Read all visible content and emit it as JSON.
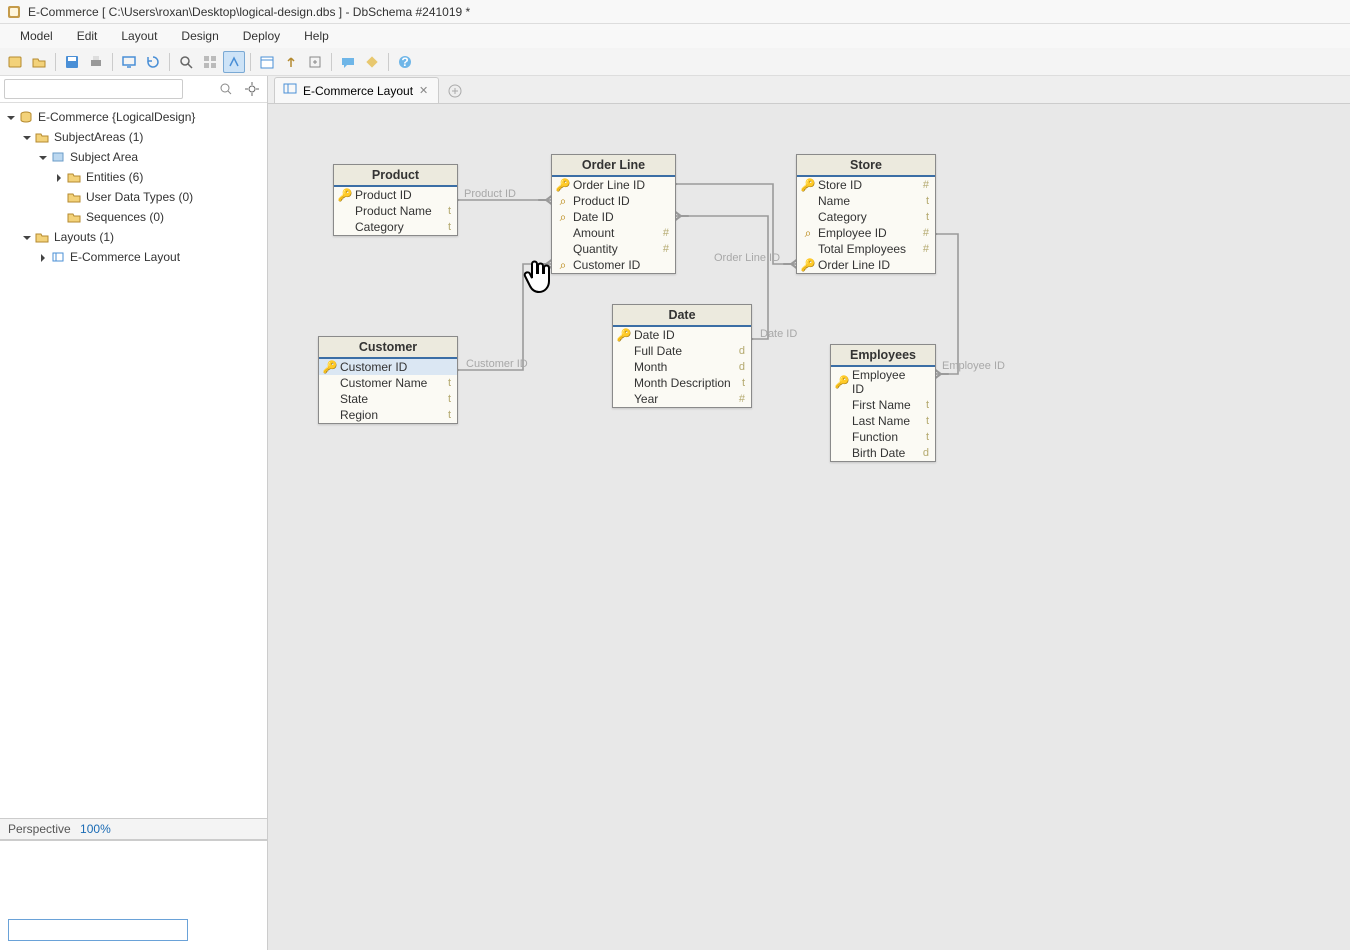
{
  "title": "E-Commerce [ C:\\Users\\roxan\\Desktop\\logical-design.dbs ] - DbSchema #241019 *",
  "menu": {
    "model": "Model",
    "edit": "Edit",
    "layout": "Layout",
    "design": "Design",
    "deploy": "Deploy",
    "help": "Help"
  },
  "tree": {
    "root": "E-Commerce {LogicalDesign}",
    "subjectAreas": "SubjectAreas (1)",
    "subjectArea": "Subject Area",
    "entities": "Entities (6)",
    "userDataTypes": "User Data Types (0)",
    "sequences": "Sequences (0)",
    "layouts": "Layouts (1)",
    "layoutItem": "E-Commerce Layout"
  },
  "perspective": {
    "label": "Perspective",
    "zoom": "100%"
  },
  "tab": {
    "label": "E-Commerce Layout",
    "close": "✕"
  },
  "labels": {
    "productId": "Product ID",
    "customerId": "Customer ID",
    "dateId": "Date ID",
    "orderLineId": "Order Line ID",
    "employeeId": "Employee ID"
  },
  "entities": {
    "product": {
      "name": "Product",
      "cols": [
        {
          "icon": "pk",
          "name": "Product ID",
          "type": ""
        },
        {
          "icon": "",
          "name": "Product Name",
          "type": "t"
        },
        {
          "icon": "",
          "name": "Category",
          "type": "t"
        }
      ]
    },
    "orderLine": {
      "name": "Order Line",
      "cols": [
        {
          "icon": "pk",
          "name": "Order Line ID",
          "type": ""
        },
        {
          "icon": "fk",
          "name": "Product ID",
          "type": ""
        },
        {
          "icon": "fk",
          "name": "Date ID",
          "type": ""
        },
        {
          "icon": "",
          "name": "Amount",
          "type": "#"
        },
        {
          "icon": "",
          "name": "Quantity",
          "type": "#"
        },
        {
          "icon": "fk",
          "name": "Customer ID",
          "type": ""
        }
      ]
    },
    "store": {
      "name": "Store",
      "cols": [
        {
          "icon": "pk",
          "name": "Store ID",
          "type": "#"
        },
        {
          "icon": "",
          "name": "Name",
          "type": "t"
        },
        {
          "icon": "",
          "name": "Category",
          "type": "t"
        },
        {
          "icon": "fk",
          "name": "Employee ID",
          "type": "#"
        },
        {
          "icon": "",
          "name": "Total Employees",
          "type": "#"
        },
        {
          "icon": "fk",
          "name": "Order Line ID",
          "type": ""
        }
      ]
    },
    "customer": {
      "name": "Customer",
      "cols": [
        {
          "icon": "pk",
          "name": "Customer ID",
          "type": ""
        },
        {
          "icon": "",
          "name": "Customer Name",
          "type": "t"
        },
        {
          "icon": "",
          "name": "State",
          "type": "t"
        },
        {
          "icon": "",
          "name": "Region",
          "type": "t"
        }
      ]
    },
    "date": {
      "name": "Date",
      "cols": [
        {
          "icon": "pk",
          "name": "Date ID",
          "type": ""
        },
        {
          "icon": "",
          "name": "Full Date",
          "type": "d"
        },
        {
          "icon": "",
          "name": "Month",
          "type": "d"
        },
        {
          "icon": "",
          "name": "Month Description",
          "type": "t"
        },
        {
          "icon": "",
          "name": "Year",
          "type": "#"
        }
      ]
    },
    "employees": {
      "name": "Employees",
      "cols": [
        {
          "icon": "pk",
          "name": "Employee ID",
          "type": ""
        },
        {
          "icon": "",
          "name": "First Name",
          "type": "t"
        },
        {
          "icon": "",
          "name": "Last Name",
          "type": "t"
        },
        {
          "icon": "",
          "name": "Function",
          "type": "t"
        },
        {
          "icon": "",
          "name": "Birth Date",
          "type": "d"
        }
      ]
    }
  }
}
